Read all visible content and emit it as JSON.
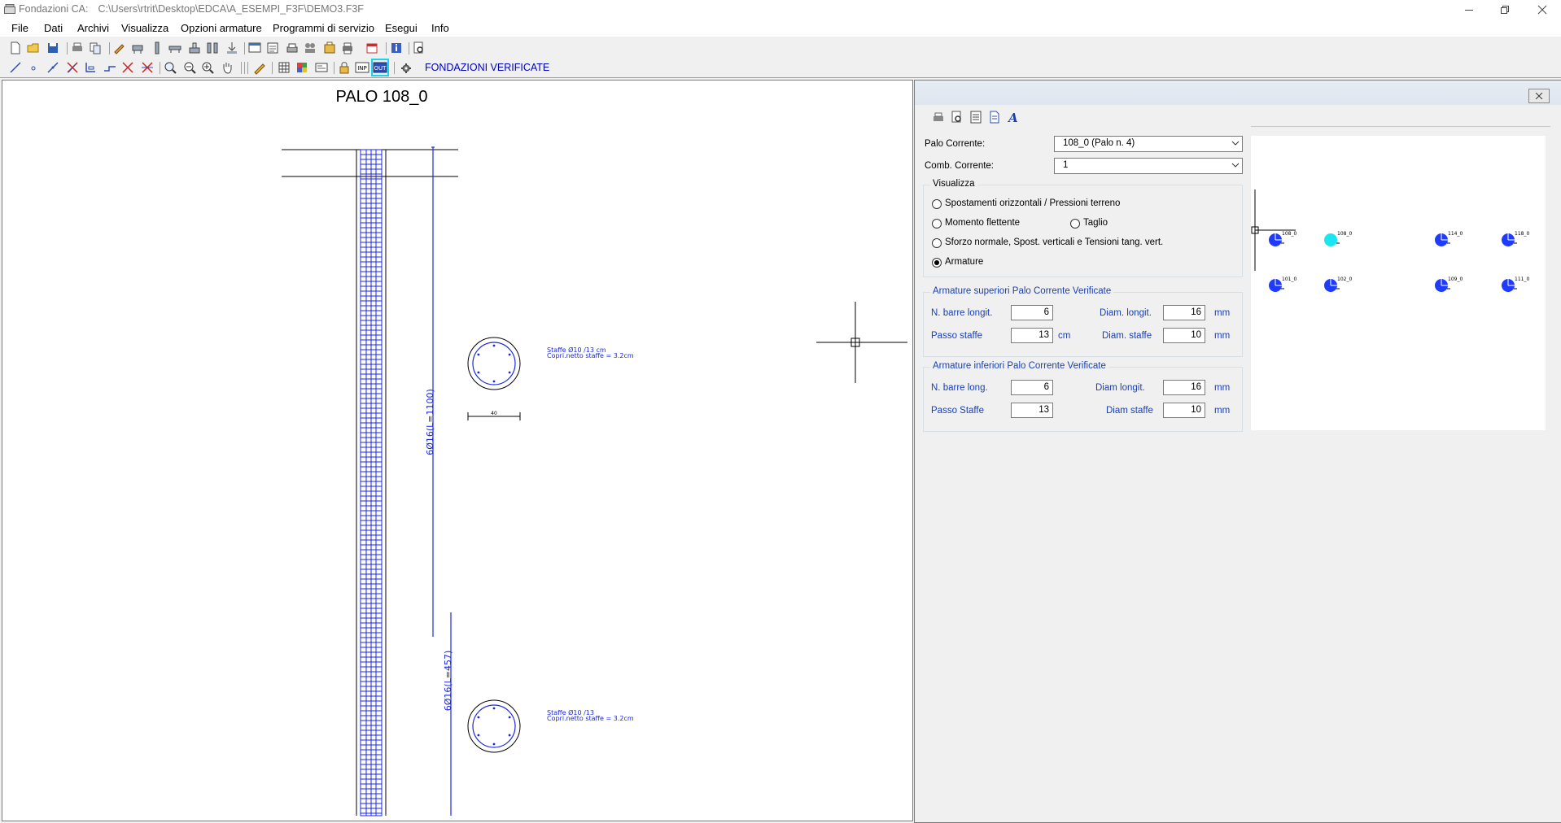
{
  "window": {
    "app_title": "Fondazioni CA:",
    "file_path": "C:\\Users\\rtrit\\Desktop\\EDCA\\A_ESEMPI_F3F\\DEMO3.F3F"
  },
  "menu": [
    "File",
    "Dati",
    "Archivi",
    "Visualizza",
    "Opzioni armature",
    "Programmi di servizio",
    "Esegui",
    "Info"
  ],
  "toolbar": {
    "status_text": "FONDAZIONI VERIFICATE",
    "inp_label": "INP",
    "out_label": "OUT"
  },
  "drawing": {
    "title": "PALO  108_0",
    "bar_label_top": "6Ø16(L=1100)",
    "bar_label_bottom": "6Ø16(L=457)",
    "dim_label": "40",
    "section_top_line1": "Staffe Ø10 /13 cm",
    "section_top_line2": "Copri.netto staffe = 3.2cm",
    "section_bottom_line1": "Staffe Ø10 /13",
    "section_bottom_line2": "Copri.netto staffe = 3.2cm"
  },
  "panel": {
    "palo_corrente_label": "Palo Corrente:",
    "palo_corrente_value": "108_0  (Palo n.  4)",
    "comb_corrente_label": "Comb. Corrente:",
    "comb_corrente_value": "1",
    "visualizza": {
      "title": "Visualizza",
      "opt_spostamenti": "Spostamenti orizzontali  / Pressioni terreno",
      "opt_momento": "Momento flettente",
      "opt_taglio": "Taglio",
      "opt_sforzo": "Sforzo normale, Spost. verticali e Tensioni tang. vert.",
      "opt_armature": "Armature",
      "selected": "Armature"
    },
    "superiori": {
      "title": "Armature superiori Palo Corrente Verificate",
      "n_barre_label": "N. barre longit.",
      "n_barre_value": "6",
      "diam_longit_label": "Diam. longit.",
      "diam_longit_value": "16",
      "diam_longit_unit": "mm",
      "passo_staffe_label": "Passo staffe",
      "passo_staffe_value": "13",
      "passo_staffe_unit": "cm",
      "diam_staffe_label": "Diam. staffe",
      "diam_staffe_value": "10",
      "diam_staffe_unit": "mm"
    },
    "inferiori": {
      "title": "Armature inferiori Palo Corrente Verificate",
      "n_barre_label": "N. barre long.",
      "n_barre_value": "6",
      "diam_longit_label": "Diam longit.",
      "diam_longit_value": "16",
      "diam_longit_unit": "mm",
      "passo_staffe_label": "Passo Staffe",
      "passo_staffe_value": "13",
      "diam_staffe_label": "Diam staffe",
      "diam_staffe_value": "10",
      "diam_staffe_unit": "mm"
    },
    "pile_labels": [
      "108_0",
      "108_0",
      "114_0",
      "118_0",
      "101_0",
      "102_0",
      "109_0",
      "111_0"
    ],
    "selected_pile_color": "#19e6f0",
    "pile_color": "#1f3bff"
  }
}
